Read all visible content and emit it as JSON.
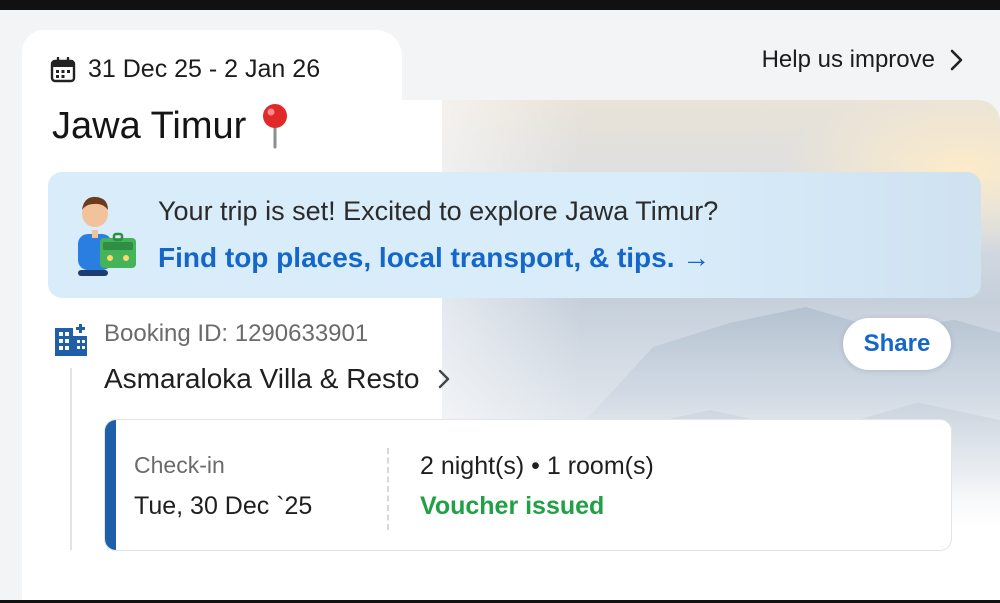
{
  "header": {
    "date_range": "31 Dec 25 - 2 Jan 26",
    "help_label": "Help us improve",
    "title": "Jawa Timur"
  },
  "banner": {
    "line1": "Your trip is set! Excited to explore Jawa Timur?",
    "line2": "Find top places, local transport, & tips. →"
  },
  "booking": {
    "id_label": "Booking ID: 1290633901",
    "hotel_name": "Asmaraloka Villa & Resto",
    "share_label": "Share",
    "checkin_label": "Check-in",
    "checkin_date": "Tue, 30 Dec `25",
    "stay_summary": "2 night(s) • 1 room(s)",
    "voucher_status": "Voucher issued"
  },
  "icons": {
    "calendar": "calendar-icon",
    "location_pin": "location-pin-icon",
    "building": "building-icon",
    "chevron": "chevron-right-icon",
    "traveler": "traveler-illustration"
  },
  "colors": {
    "accent_blue": "#1467c9",
    "banner_bg": "#d8ecfa",
    "success_green": "#21a046",
    "checkin_accent": "#1f5fa8"
  }
}
